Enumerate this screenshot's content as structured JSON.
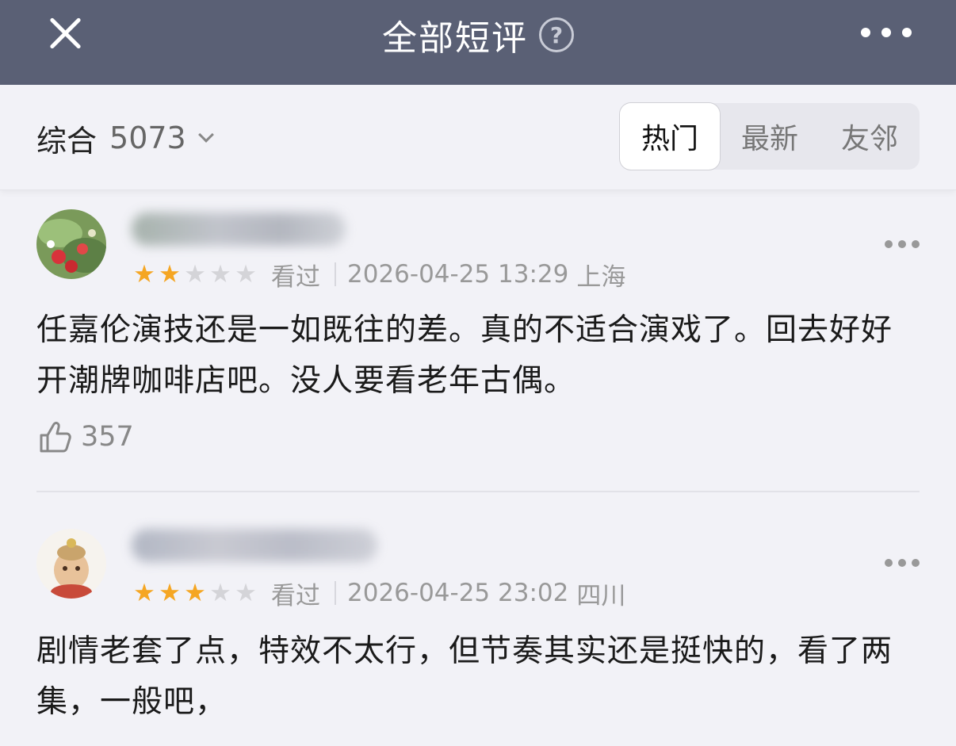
{
  "header": {
    "title": "全部短评",
    "help_symbol": "?",
    "close_icon": "close-icon",
    "more_icon": "more-horizontal-icon",
    "background": "#5a6075"
  },
  "filter": {
    "sort_label": "综合",
    "count": "5073",
    "tabs": [
      {
        "label": "热门",
        "active": true
      },
      {
        "label": "最新",
        "active": false
      },
      {
        "label": "友邻",
        "active": false
      }
    ]
  },
  "comments": [
    {
      "rating": 2,
      "rating_max": 5,
      "status": "看过",
      "datetime": "2026-04-25 13:29",
      "location": "上海",
      "text": "任嘉伦演技还是一如既往的差。真的不适合演戏了。回去好好开潮牌咖啡店吧。没人要看老年古偶。",
      "likes": "357"
    },
    {
      "rating": 3,
      "rating_max": 5,
      "status": "看过",
      "datetime": "2026-04-25 23:02",
      "location": "四川",
      "text": "剧情老套了点，特效不太行，但节奏其实还是挺快的，看了两集，一般吧，"
    }
  ],
  "colors": {
    "star_on": "#f5a623",
    "star_off": "#d4d4d8",
    "page_bg": "#f2f2f7"
  }
}
